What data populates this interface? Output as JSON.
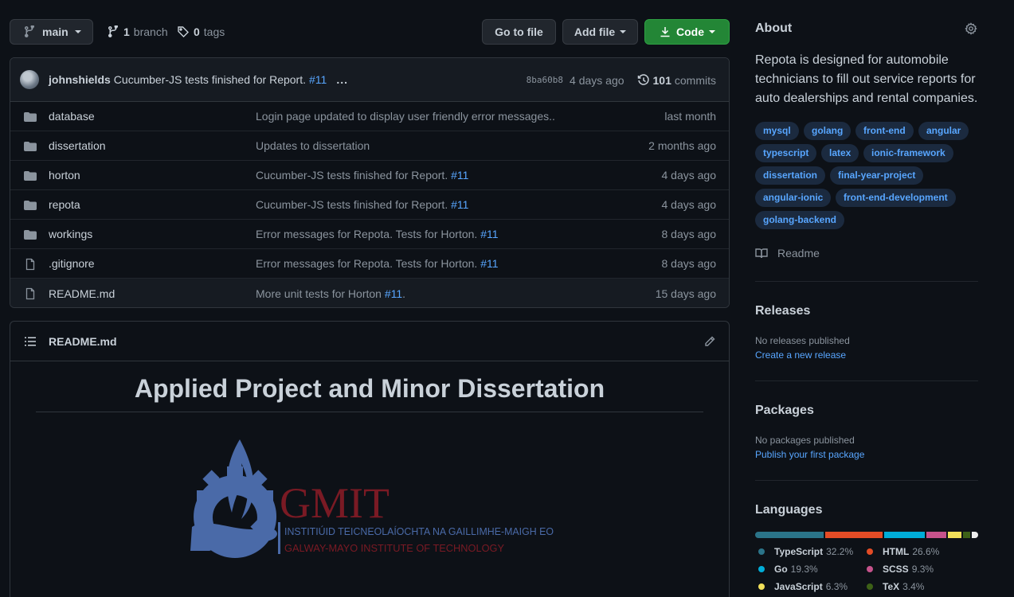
{
  "toolbar": {
    "branch": "main",
    "branches_count": "1",
    "branches_label": "branch",
    "tags_count": "0",
    "tags_label": "tags",
    "go_to_file": "Go to file",
    "add_file": "Add file",
    "code": "Code"
  },
  "commit": {
    "author": "johnshields",
    "message": "Cucumber-JS tests finished for Report.",
    "issue": "#11",
    "dots": "...",
    "sha": "8ba60b8",
    "time": "4 days ago",
    "commits_count": "101",
    "commits_label": "commits"
  },
  "files": [
    {
      "type": "folder",
      "name": "database",
      "message": "Login page updated to display user friendly error messages..",
      "issue": "",
      "suffix": "",
      "time": "last month"
    },
    {
      "type": "folder",
      "name": "dissertation",
      "message": "Updates to dissertation",
      "issue": "",
      "suffix": "",
      "time": "2 months ago"
    },
    {
      "type": "folder",
      "name": "horton",
      "message": "Cucumber-JS tests finished for Report.",
      "issue": "#11",
      "suffix": "",
      "time": "4 days ago"
    },
    {
      "type": "folder",
      "name": "repota",
      "message": "Cucumber-JS tests finished for Report.",
      "issue": "#11",
      "suffix": "",
      "time": "4 days ago"
    },
    {
      "type": "folder",
      "name": "workings",
      "message": "Error messages for Repota. Tests for Horton.",
      "issue": "#11",
      "suffix": "",
      "time": "8 days ago"
    },
    {
      "type": "file",
      "name": ".gitignore",
      "message": "Error messages for Repota. Tests for Horton.",
      "issue": "#11",
      "suffix": "",
      "time": "8 days ago"
    },
    {
      "type": "file",
      "name": "README.md",
      "message": "More unit tests for Horton",
      "issue": "#11",
      "suffix": ".",
      "time": "15 days ago"
    }
  ],
  "readme": {
    "filename": "README.md",
    "heading": "Applied Project and Minor Dissertation",
    "logo_text": "GMIT",
    "logo_line1": "INSTITIÚID TEICNEOLAÍOCHTA NA GAILLIMHE-MAIGH EO",
    "logo_line2": "GALWAY-MAYO INSTITUTE OF TECHNOLOGY"
  },
  "about": {
    "title": "About",
    "description": "Repota is designed for automobile technicians to fill out service reports for auto dealerships and rental companies.",
    "topics": [
      "mysql",
      "golang",
      "front-end",
      "angular",
      "typescript",
      "latex",
      "ionic-framework",
      "dissertation",
      "final-year-project",
      "angular-ionic",
      "front-end-development",
      "golang-backend"
    ],
    "readme_label": "Readme"
  },
  "releases": {
    "title": "Releases",
    "note": "No releases published",
    "link": "Create a new release"
  },
  "packages": {
    "title": "Packages",
    "note": "No packages published",
    "link": "Publish your first package"
  },
  "languages": {
    "title": "Languages",
    "items": [
      {
        "name": "TypeScript",
        "percent": "32.2%",
        "value": 32.2,
        "color": "#2b7489"
      },
      {
        "name": "HTML",
        "percent": "26.6%",
        "value": 26.6,
        "color": "#e34c26"
      },
      {
        "name": "Go",
        "percent": "19.3%",
        "value": 19.3,
        "color": "#00add8"
      },
      {
        "name": "SCSS",
        "percent": "9.3%",
        "value": 9.3,
        "color": "#c6538c"
      },
      {
        "name": "JavaScript",
        "percent": "6.3%",
        "value": 6.3,
        "color": "#f1e05a"
      },
      {
        "name": "TeX",
        "percent": "3.4%",
        "value": 3.4,
        "color": "#3d6117"
      }
    ],
    "other_value": 2.9,
    "other_color": "#ededed"
  }
}
